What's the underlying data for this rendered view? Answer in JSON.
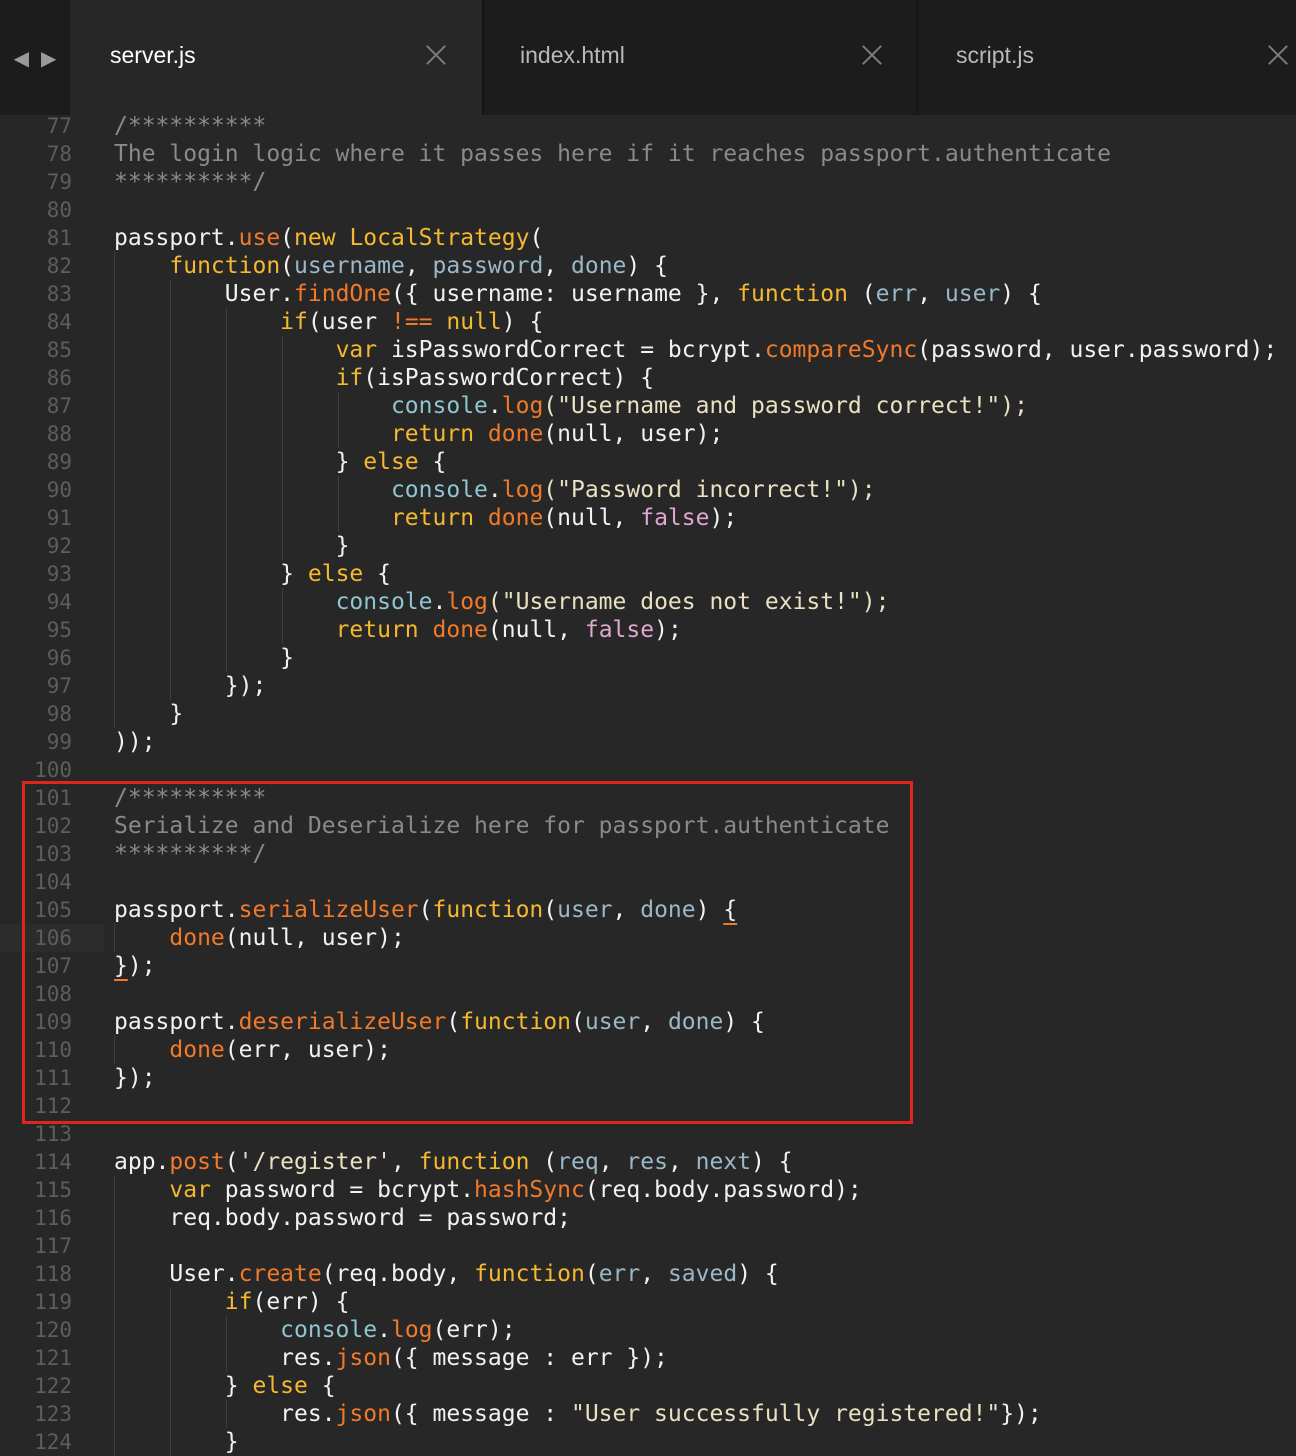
{
  "tabs": [
    {
      "label": "server.js",
      "active": true
    },
    {
      "label": "index.html",
      "active": false
    },
    {
      "label": "script.js",
      "active": false
    }
  ],
  "nav": {
    "back": "◀",
    "forward": "▶"
  },
  "colors": {
    "background": "#272727",
    "tabbar": "#1c1c1c",
    "comment": "#8a8a8a",
    "keyword": "#f5b82e",
    "function": "#f07a2a",
    "parameter": "#9ab8c8",
    "object": "#8ec5d1",
    "boolean": "#e0a8d0",
    "highlight_box": "#e0251f"
  },
  "current_line": 106,
  "highlight_box": {
    "from_line": 101,
    "to_line": 112
  },
  "lines": [
    {
      "n": "77",
      "indent": 0,
      "tokens": [
        [
          "/**********",
          "cmt"
        ]
      ]
    },
    {
      "n": "78",
      "indent": 0,
      "tokens": [
        [
          "The login logic where it passes here if it reaches passport.authenticate",
          "cmt"
        ]
      ]
    },
    {
      "n": "79",
      "indent": 0,
      "tokens": [
        [
          "**********/",
          "cmt"
        ]
      ]
    },
    {
      "n": "80",
      "indent": 0,
      "tokens": []
    },
    {
      "n": "81",
      "indent": 0,
      "tokens": [
        [
          "passport.",
          "plain"
        ],
        [
          "use",
          "fn"
        ],
        [
          "(",
          "plain"
        ],
        [
          "new",
          "kw"
        ],
        [
          " ",
          "plain"
        ],
        [
          "LocalStrategy",
          "kw"
        ],
        [
          "(",
          "plain"
        ]
      ]
    },
    {
      "n": "82",
      "indent": 1,
      "tokens": [
        [
          "function",
          "kw"
        ],
        [
          "(",
          "plain"
        ],
        [
          "username",
          "pm"
        ],
        [
          ", ",
          "plain"
        ],
        [
          "password",
          "pm"
        ],
        [
          ", ",
          "plain"
        ],
        [
          "done",
          "pm"
        ],
        [
          ") {",
          "plain"
        ]
      ]
    },
    {
      "n": "83",
      "indent": 2,
      "tokens": [
        [
          "User.",
          "plain"
        ],
        [
          "findOne",
          "fn"
        ],
        [
          "({ username: username }, ",
          "plain"
        ],
        [
          "function",
          "kw"
        ],
        [
          " (",
          "plain"
        ],
        [
          "err",
          "pm"
        ],
        [
          ", ",
          "plain"
        ],
        [
          "user",
          "pm"
        ],
        [
          ") {",
          "plain"
        ]
      ]
    },
    {
      "n": "84",
      "indent": 3,
      "tokens": [
        [
          "if",
          "kw"
        ],
        [
          "(user ",
          "plain"
        ],
        [
          "!==",
          "op"
        ],
        [
          " ",
          "plain"
        ],
        [
          "null",
          "kw"
        ],
        [
          ") {",
          "plain"
        ]
      ]
    },
    {
      "n": "85",
      "indent": 4,
      "tokens": [
        [
          "var",
          "kw"
        ],
        [
          " isPasswordCorrect = bcrypt.",
          "plain"
        ],
        [
          "compareSync",
          "fn"
        ],
        [
          "(password, user.password);",
          "plain"
        ]
      ]
    },
    {
      "n": "86",
      "indent": 4,
      "tokens": [
        [
          "if",
          "kw"
        ],
        [
          "(isPasswordCorrect) {",
          "plain"
        ]
      ]
    },
    {
      "n": "87",
      "indent": 5,
      "tokens": [
        [
          "console",
          "obj"
        ],
        [
          ".",
          "plain"
        ],
        [
          "log",
          "fn"
        ],
        [
          "(\"Username and password correct!\");",
          "str"
        ]
      ]
    },
    {
      "n": "88",
      "indent": 5,
      "tokens": [
        [
          "return",
          "kw"
        ],
        [
          " ",
          "plain"
        ],
        [
          "done",
          "fn"
        ],
        [
          "(null, user);",
          "plain"
        ]
      ]
    },
    {
      "n": "89",
      "indent": 4,
      "tokens": [
        [
          "} ",
          "plain"
        ],
        [
          "else",
          "kw"
        ],
        [
          " {",
          "plain"
        ]
      ]
    },
    {
      "n": "90",
      "indent": 5,
      "tokens": [
        [
          "console",
          "obj"
        ],
        [
          ".",
          "plain"
        ],
        [
          "log",
          "fn"
        ],
        [
          "(\"Password incorrect!\");",
          "str"
        ]
      ]
    },
    {
      "n": "91",
      "indent": 5,
      "tokens": [
        [
          "return",
          "kw"
        ],
        [
          " ",
          "plain"
        ],
        [
          "done",
          "fn"
        ],
        [
          "(null, ",
          "plain"
        ],
        [
          "false",
          "bool"
        ],
        [
          ");",
          "plain"
        ]
      ]
    },
    {
      "n": "92",
      "indent": 4,
      "tokens": [
        [
          "}",
          "plain"
        ]
      ]
    },
    {
      "n": "93",
      "indent": 3,
      "tokens": [
        [
          "} ",
          "plain"
        ],
        [
          "else",
          "kw"
        ],
        [
          " {",
          "plain"
        ]
      ]
    },
    {
      "n": "94",
      "indent": 4,
      "tokens": [
        [
          "console",
          "obj"
        ],
        [
          ".",
          "plain"
        ],
        [
          "log",
          "fn"
        ],
        [
          "(\"Username does not exist!\");",
          "str"
        ]
      ]
    },
    {
      "n": "95",
      "indent": 4,
      "tokens": [
        [
          "return",
          "kw"
        ],
        [
          " ",
          "plain"
        ],
        [
          "done",
          "fn"
        ],
        [
          "(null, ",
          "plain"
        ],
        [
          "false",
          "bool"
        ],
        [
          ");",
          "plain"
        ]
      ]
    },
    {
      "n": "96",
      "indent": 3,
      "tokens": [
        [
          "}",
          "plain"
        ]
      ]
    },
    {
      "n": "97",
      "indent": 2,
      "tokens": [
        [
          "});",
          "plain"
        ]
      ]
    },
    {
      "n": "98",
      "indent": 1,
      "tokens": [
        [
          "}",
          "plain"
        ]
      ]
    },
    {
      "n": "99",
      "indent": 0,
      "tokens": [
        [
          "));",
          "plain"
        ]
      ]
    },
    {
      "n": "100",
      "indent": 0,
      "tokens": []
    },
    {
      "n": "101",
      "indent": 0,
      "tokens": [
        [
          "/**********",
          "cmt"
        ]
      ]
    },
    {
      "n": "102",
      "indent": 0,
      "tokens": [
        [
          "Serialize and Deserialize here for passport.authenticate",
          "cmt"
        ]
      ]
    },
    {
      "n": "103",
      "indent": 0,
      "tokens": [
        [
          "**********/",
          "cmt"
        ]
      ]
    },
    {
      "n": "104",
      "indent": 0,
      "tokens": []
    },
    {
      "n": "105",
      "indent": 0,
      "tokens": [
        [
          "passport.",
          "plain"
        ],
        [
          "serializeUser",
          "fn"
        ],
        [
          "(",
          "plain"
        ],
        [
          "function",
          "kw"
        ],
        [
          "(",
          "plain"
        ],
        [
          "user",
          "pm"
        ],
        [
          ", ",
          "plain"
        ],
        [
          "done",
          "pm"
        ],
        [
          ") ",
          "plain"
        ],
        [
          "{",
          "ubrace"
        ]
      ]
    },
    {
      "n": "106",
      "indent": 1,
      "tokens": [
        [
          "done",
          "fn"
        ],
        [
          "(null, user);",
          "plain"
        ]
      ]
    },
    {
      "n": "107",
      "indent": 0,
      "tokens": [
        [
          "}",
          "ubrace"
        ],
        [
          ");",
          "plain"
        ]
      ]
    },
    {
      "n": "108",
      "indent": 0,
      "tokens": []
    },
    {
      "n": "109",
      "indent": 0,
      "tokens": [
        [
          "passport.",
          "plain"
        ],
        [
          "deserializeUser",
          "fn"
        ],
        [
          "(",
          "plain"
        ],
        [
          "function",
          "kw"
        ],
        [
          "(",
          "plain"
        ],
        [
          "user",
          "pm"
        ],
        [
          ", ",
          "plain"
        ],
        [
          "done",
          "pm"
        ],
        [
          ") {",
          "plain"
        ]
      ]
    },
    {
      "n": "110",
      "indent": 1,
      "tokens": [
        [
          "done",
          "fn"
        ],
        [
          "(err, user);",
          "plain"
        ]
      ]
    },
    {
      "n": "111",
      "indent": 0,
      "tokens": [
        [
          "});",
          "plain"
        ]
      ]
    },
    {
      "n": "112",
      "indent": 0,
      "tokens": []
    },
    {
      "n": "113",
      "indent": 0,
      "tokens": []
    },
    {
      "n": "114",
      "indent": 0,
      "tokens": [
        [
          "app.",
          "plain"
        ],
        [
          "post",
          "fn"
        ],
        [
          "(",
          "plain"
        ],
        [
          "'/register'",
          "str"
        ],
        [
          ", ",
          "plain"
        ],
        [
          "function",
          "kw"
        ],
        [
          " (",
          "plain"
        ],
        [
          "req",
          "pm"
        ],
        [
          ", ",
          "plain"
        ],
        [
          "res",
          "pm"
        ],
        [
          ", ",
          "plain"
        ],
        [
          "next",
          "pm"
        ],
        [
          ") {",
          "plain"
        ]
      ]
    },
    {
      "n": "115",
      "indent": 1,
      "tokens": [
        [
          "var",
          "kw"
        ],
        [
          " password = bcrypt.",
          "plain"
        ],
        [
          "hashSync",
          "fn"
        ],
        [
          "(req.body.password);",
          "plain"
        ]
      ]
    },
    {
      "n": "116",
      "indent": 1,
      "tokens": [
        [
          "req.body.password = password;",
          "plain"
        ]
      ]
    },
    {
      "n": "117",
      "indent": 0,
      "tokens": []
    },
    {
      "n": "118",
      "indent": 1,
      "tokens": [
        [
          "User.",
          "plain"
        ],
        [
          "create",
          "fn"
        ],
        [
          "(req.body, ",
          "plain"
        ],
        [
          "function",
          "kw"
        ],
        [
          "(",
          "plain"
        ],
        [
          "err",
          "pm"
        ],
        [
          ", ",
          "plain"
        ],
        [
          "saved",
          "pm"
        ],
        [
          ") {",
          "plain"
        ]
      ]
    },
    {
      "n": "119",
      "indent": 2,
      "tokens": [
        [
          "if",
          "kw"
        ],
        [
          "(err) {",
          "plain"
        ]
      ]
    },
    {
      "n": "120",
      "indent": 3,
      "tokens": [
        [
          "console",
          "obj"
        ],
        [
          ".",
          "plain"
        ],
        [
          "log",
          "fn"
        ],
        [
          "(err);",
          "plain"
        ]
      ]
    },
    {
      "n": "121",
      "indent": 3,
      "tokens": [
        [
          "res.",
          "plain"
        ],
        [
          "json",
          "fn"
        ],
        [
          "({ message : err });",
          "plain"
        ]
      ]
    },
    {
      "n": "122",
      "indent": 2,
      "tokens": [
        [
          "} ",
          "plain"
        ],
        [
          "else",
          "kw"
        ],
        [
          " {",
          "plain"
        ]
      ]
    },
    {
      "n": "123",
      "indent": 3,
      "tokens": [
        [
          "res.",
          "plain"
        ],
        [
          "json",
          "fn"
        ],
        [
          "({ message : ",
          "plain"
        ],
        [
          "\"User successfully registered!\"",
          "str"
        ],
        [
          "});",
          "plain"
        ]
      ]
    },
    {
      "n": "124",
      "indent": 2,
      "tokens": [
        [
          "}",
          "plain"
        ]
      ]
    }
  ]
}
